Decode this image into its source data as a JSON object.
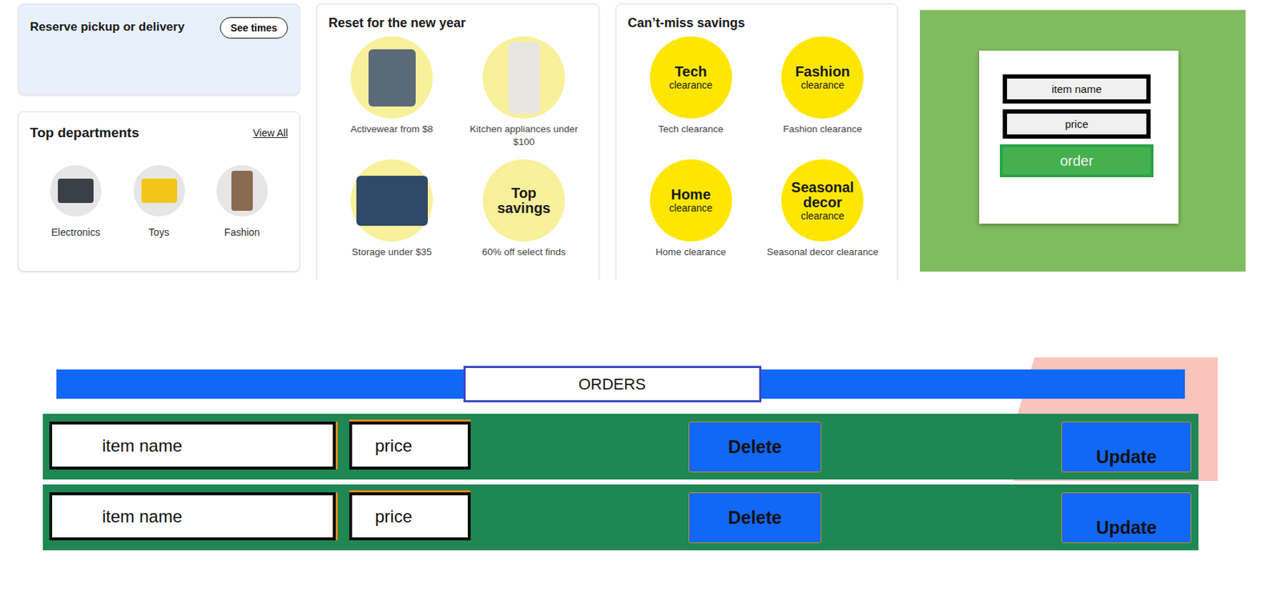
{
  "pickup": {
    "title": "Reserve pickup or delivery",
    "button": "See times"
  },
  "departments": {
    "title": "Top departments",
    "link": "View All",
    "items": [
      {
        "label": "Electronics"
      },
      {
        "label": "Toys"
      },
      {
        "label": "Fashion"
      }
    ]
  },
  "promo": {
    "title": "Reset for the new year",
    "items": [
      {
        "kind": "photo",
        "badge": "",
        "label": "Activewear from $8"
      },
      {
        "kind": "photo",
        "badge": "",
        "label": "Kitchen appliances under $100"
      },
      {
        "kind": "photo",
        "badge": "",
        "label": "Storage under $35"
      },
      {
        "kind": "text",
        "badge": "Top savings",
        "label": "60% off select finds"
      }
    ]
  },
  "savings": {
    "title": "Can’t-miss savings",
    "items": [
      {
        "name": "Tech",
        "sub": "clearance",
        "label": "Tech clearance"
      },
      {
        "name": "Fashion",
        "sub": "clearance",
        "label": "Fashion clearance"
      },
      {
        "name": "Home",
        "sub": "clearance",
        "label": "Home clearance"
      },
      {
        "name": "Seasonal decor",
        "sub": "clearance",
        "label": "Seasonal decor clearance"
      }
    ]
  },
  "order_form": {
    "fields": [
      {
        "placeholder": "item name"
      },
      {
        "placeholder": "price"
      }
    ],
    "button": "order"
  },
  "orders": {
    "title": "ORDERS",
    "rows": [
      {
        "item": "item name",
        "price": "price",
        "buttons": [
          "Delete",
          "Update"
        ]
      },
      {
        "item": "item name",
        "price": "price",
        "buttons": [
          "Delete",
          "Update"
        ]
      }
    ]
  }
}
